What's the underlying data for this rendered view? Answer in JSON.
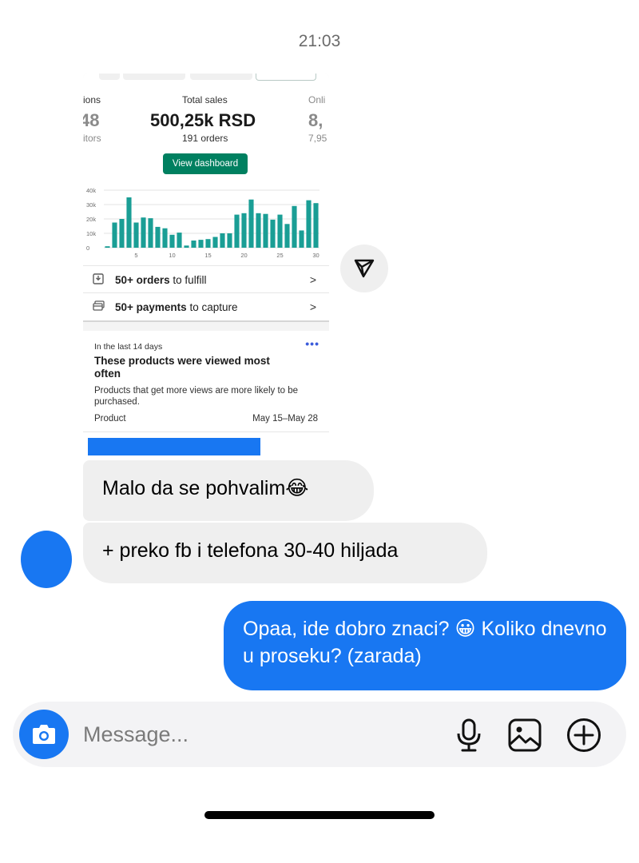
{
  "status": {
    "time": "21:03"
  },
  "shared_screenshot": {
    "stats": {
      "left_label": "ions",
      "left_value": "48",
      "left_sub": "itors",
      "center_label": "Total sales",
      "center_value": "500,25k RSD",
      "center_sub": "191 orders",
      "right_label": "Onli",
      "right_value": "8,",
      "right_sub": "7,95"
    },
    "view_dashboard_label": "View dashboard",
    "chart_data": {
      "type": "bar",
      "title": "",
      "xlabel": "",
      "ylabel": "",
      "ylim": [
        0,
        40000
      ],
      "ytick_labels": [
        "40k",
        "30k",
        "20k",
        "10k",
        "0"
      ],
      "xtick_labels": [
        "5",
        "10",
        "15",
        "20",
        "25",
        "30"
      ],
      "grid": true,
      "color": "#1a9e95",
      "x": [
        1,
        2,
        3,
        4,
        5,
        6,
        7,
        8,
        9,
        10,
        11,
        12,
        13,
        14,
        15,
        16,
        17,
        18,
        19,
        20,
        21,
        22,
        23,
        24,
        25,
        26,
        27,
        28,
        29,
        30
      ],
      "values": [
        1000,
        17500,
        20000,
        35000,
        17500,
        21000,
        20500,
        14500,
        13500,
        9000,
        10500,
        1500,
        5000,
        5500,
        6000,
        7500,
        10000,
        10000,
        23000,
        24000,
        33500,
        24000,
        23500,
        19500,
        23000,
        16500,
        29000,
        12000,
        33000,
        31000
      ]
    },
    "rows": [
      {
        "bold": "50+ orders",
        "rest": " to fulfill",
        "chevron": ">"
      },
      {
        "bold": "50+ payments",
        "rest": " to capture",
        "chevron": ">"
      }
    ],
    "views_card": {
      "period": "In the last 14 days",
      "more": "•••",
      "heading": "These products were viewed most often",
      "description": "Products that get more views are more likely to be purchased.",
      "col_product": "Product",
      "col_range": "May 15–May 28"
    }
  },
  "messages": [
    {
      "direction": "incoming",
      "text": "Malo da se pohvalim😂"
    },
    {
      "direction": "incoming",
      "text": "+ preko fb i telefona 30-40 hiljada"
    },
    {
      "direction": "outgoing",
      "text": "Opaa, ide dobro znaci? 😀 Koliko dnevno u proseku? (zarada)"
    }
  ],
  "composer": {
    "placeholder": "Message...",
    "icons": [
      "camera-icon",
      "microphone-icon",
      "image-icon",
      "plus-circle-icon"
    ]
  },
  "colors": {
    "accent_blue": "#1877f2",
    "shopify_green": "#008060",
    "bar_teal": "#1a9e95",
    "incoming_bubble": "#efefef"
  }
}
